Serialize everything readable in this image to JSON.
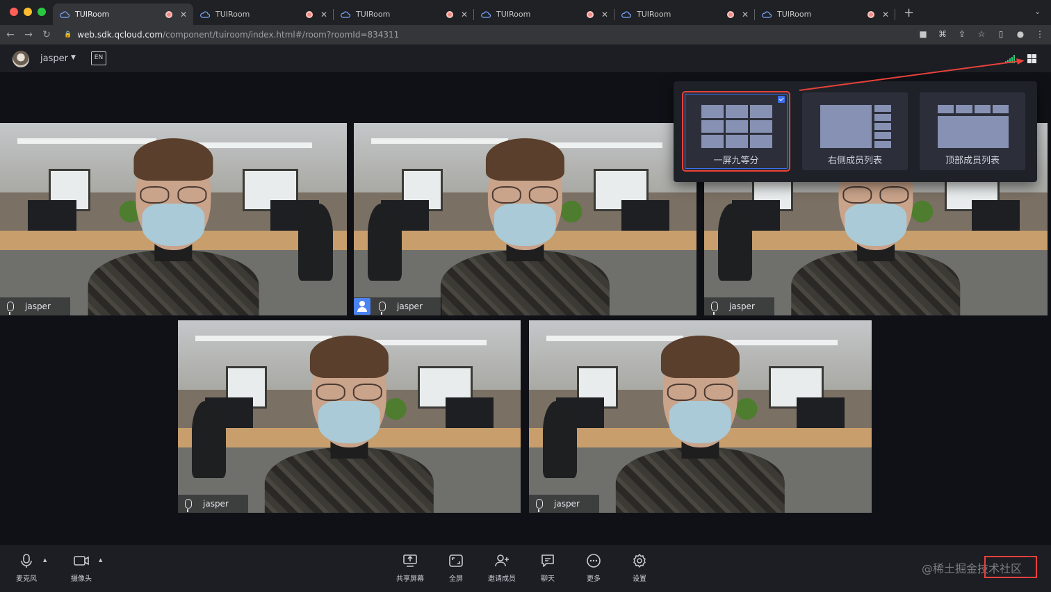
{
  "browser": {
    "tabs": [
      {
        "title": "TUIRoom",
        "active": true
      },
      {
        "title": "TUIRoom",
        "active": false
      },
      {
        "title": "TUIRoom",
        "active": false
      },
      {
        "title": "TUIRoom",
        "active": false
      },
      {
        "title": "TUIRoom",
        "active": false
      },
      {
        "title": "TUIRoom",
        "active": false
      }
    ],
    "url_host": "web.sdk.qcloud.com",
    "url_path": "/component/tuiroom/index.html#/room?roomId=834311"
  },
  "header": {
    "username": "jasper",
    "lang_icon": "language-switch-icon",
    "signal_color": "#2ec97a"
  },
  "videos": [
    {
      "name": "jasper",
      "is_self": false
    },
    {
      "name": "jasper",
      "is_self": true
    },
    {
      "name": "jasper",
      "is_self": false
    },
    {
      "name": "jasper",
      "is_self": false
    },
    {
      "name": "jasper",
      "is_self": false
    }
  ],
  "layout_popup": {
    "options": [
      {
        "label": "一屏九等分",
        "selected": true
      },
      {
        "label": "右侧成员列表",
        "selected": false
      },
      {
        "label": "顶部成员列表",
        "selected": false
      }
    ],
    "highlight_color": "#e8413a"
  },
  "toolbar": {
    "mic_label": "麦克风",
    "camera_label": "摄像头",
    "share_label": "共享屏幕",
    "fullscreen_label": "全屏",
    "invite_label": "邀请成员",
    "chat_label": "聊天",
    "more_label": "更多",
    "settings_label": "设置"
  },
  "watermark": "@稀土掘金技术社区"
}
